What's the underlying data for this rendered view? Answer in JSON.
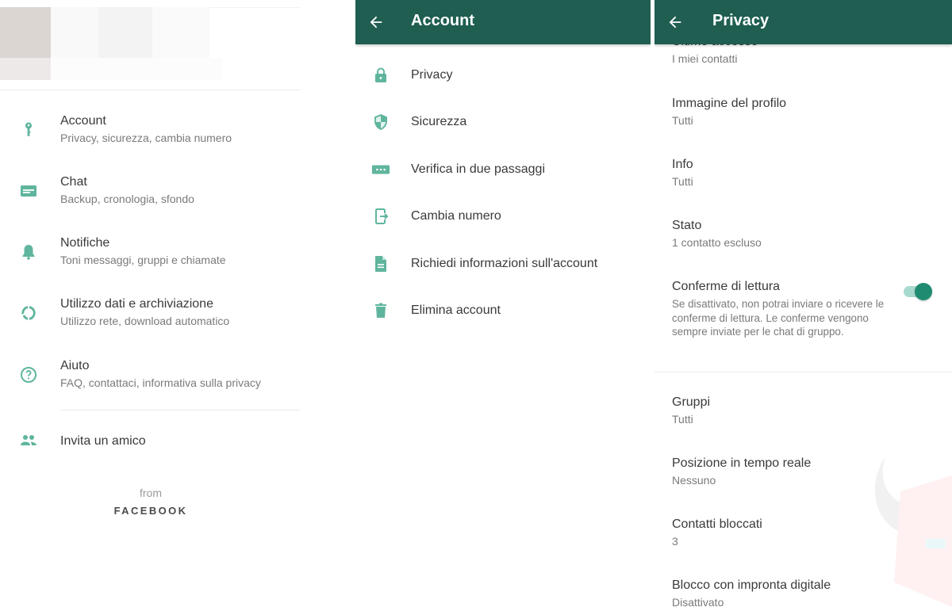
{
  "colors": {
    "appbar": "#1f5e51",
    "icon_accent": "#5fb59d",
    "toggle_on": "#1f8c72"
  },
  "settings": {
    "items": [
      {
        "icon": "key-icon",
        "title": "Account",
        "subtitle": "Privacy, sicurezza, cambia numero"
      },
      {
        "icon": "chat-icon",
        "title": "Chat",
        "subtitle": "Backup, cronologia, sfondo"
      },
      {
        "icon": "bell-icon",
        "title": "Notifiche",
        "subtitle": "Toni messaggi, gruppi e chiamate"
      },
      {
        "icon": "data-usage-icon",
        "title": "Utilizzo dati e archiviazione",
        "subtitle": "Utilizzo rete, download automatico"
      },
      {
        "icon": "help-icon",
        "title": "Aiuto",
        "subtitle": "FAQ, contattaci, informativa sulla privacy"
      }
    ],
    "invite": {
      "icon": "people-icon",
      "title": "Invita un amico"
    },
    "from_label": "from",
    "brand": "FACEBOOK"
  },
  "account": {
    "title": "Account",
    "items": [
      {
        "icon": "lock-icon",
        "label": "Privacy"
      },
      {
        "icon": "shield-icon",
        "label": "Sicurezza"
      },
      {
        "icon": "two-step-icon",
        "label": "Verifica in due passaggi"
      },
      {
        "icon": "change-number-icon",
        "label": "Cambia numero"
      },
      {
        "icon": "document-icon",
        "label": "Richiedi informazioni sull'account"
      },
      {
        "icon": "trash-icon",
        "label": "Elimina account"
      }
    ]
  },
  "privacy": {
    "title": "Privacy",
    "partial_item": {
      "title": "Ultimo accesso",
      "value": "I miei contatti"
    },
    "items": [
      {
        "title": "Immagine del profilo",
        "value": "Tutti"
      },
      {
        "title": "Info",
        "value": "Tutti"
      },
      {
        "title": "Stato",
        "value": "1 contatto escluso"
      }
    ],
    "read_receipts": {
      "title": "Conferme di lettura",
      "description": "Se disattivato, non potrai inviare o ricevere le conferme di lettura. Le conferme vengono sempre inviate per le chat di gruppo.",
      "enabled": true
    },
    "items2": [
      {
        "title": "Gruppi",
        "value": "Tutti"
      },
      {
        "title": "Posizione in tempo reale",
        "value": "Nessuno"
      },
      {
        "title": "Contatti bloccati",
        "value": "3"
      },
      {
        "title": "Blocco con impronta digitale",
        "value": "Disattivato"
      }
    ]
  }
}
